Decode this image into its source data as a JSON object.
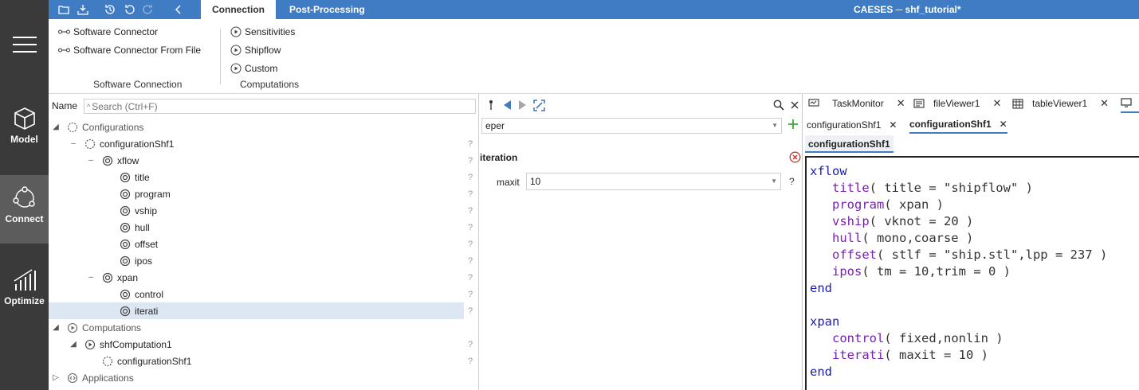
{
  "nav": {
    "items": [
      {
        "label": "Model",
        "icon": "cube-icon"
      },
      {
        "label": "Connect",
        "icon": "connect-icon"
      },
      {
        "label": "Optimize",
        "icon": "chart-icon"
      }
    ]
  },
  "topbar": {
    "tabs": [
      "Connection",
      "Post-Processing"
    ],
    "title": "CAESES ─ shf_tutorial*"
  },
  "ribbon": {
    "software": [
      "Software Connector",
      "Software Connector From File"
    ],
    "software_group": "Software Connection",
    "computations": [
      "Sensitivities",
      "Shipflow",
      "Custom"
    ],
    "computations_group": "Computations"
  },
  "tree": {
    "name_label": "Name",
    "search_placeholder": "Search (Ctrl+F)",
    "rows": [
      {
        "label": "Configurations"
      },
      {
        "label": "configurationShf1"
      },
      {
        "label": "xflow"
      },
      {
        "label": "title"
      },
      {
        "label": "program"
      },
      {
        "label": "vship"
      },
      {
        "label": "hull"
      },
      {
        "label": "offset"
      },
      {
        "label": "ipos"
      },
      {
        "label": "xpan"
      },
      {
        "label": "control"
      },
      {
        "label": "iterati"
      },
      {
        "label": "Computations"
      },
      {
        "label": "shfComputation1"
      },
      {
        "label": "configurationShf1"
      },
      {
        "label": "Applications"
      }
    ],
    "qmark": "?"
  },
  "mid": {
    "command": "eper",
    "section_title": "iteration",
    "param_label": "maxit",
    "param_value": "10",
    "help": "?"
  },
  "right": {
    "tabs": [
      "TaskMonitor",
      "fileViewer1",
      "tableViewer1"
    ],
    "subtabs": [
      "configurationShf1",
      "configurationShf1"
    ],
    "file_tab": "configurationShf1",
    "code_lines": [
      "xflow",
      "   title( title = \"shipflow\" )",
      "   program( xpan )",
      "   vship( vknot = 20 )",
      "   hull( mono,coarse )",
      "   offset( stlf = \"ship.stl\",lpp = 237 )",
      "   ipos( tm = 10,trim = 0 )",
      "end",
      "",
      "xpan",
      "   control( fixed,nonlin )",
      "   iterati( maxit = 10 )",
      "end"
    ]
  },
  "colors": {
    "accent": "#3f7cc3",
    "nav_bg": "#3a3a3a",
    "nav_active": "#5c5c5c",
    "selection": "#dde7f4",
    "error": "#d0312d",
    "add": "#3aa83a"
  }
}
